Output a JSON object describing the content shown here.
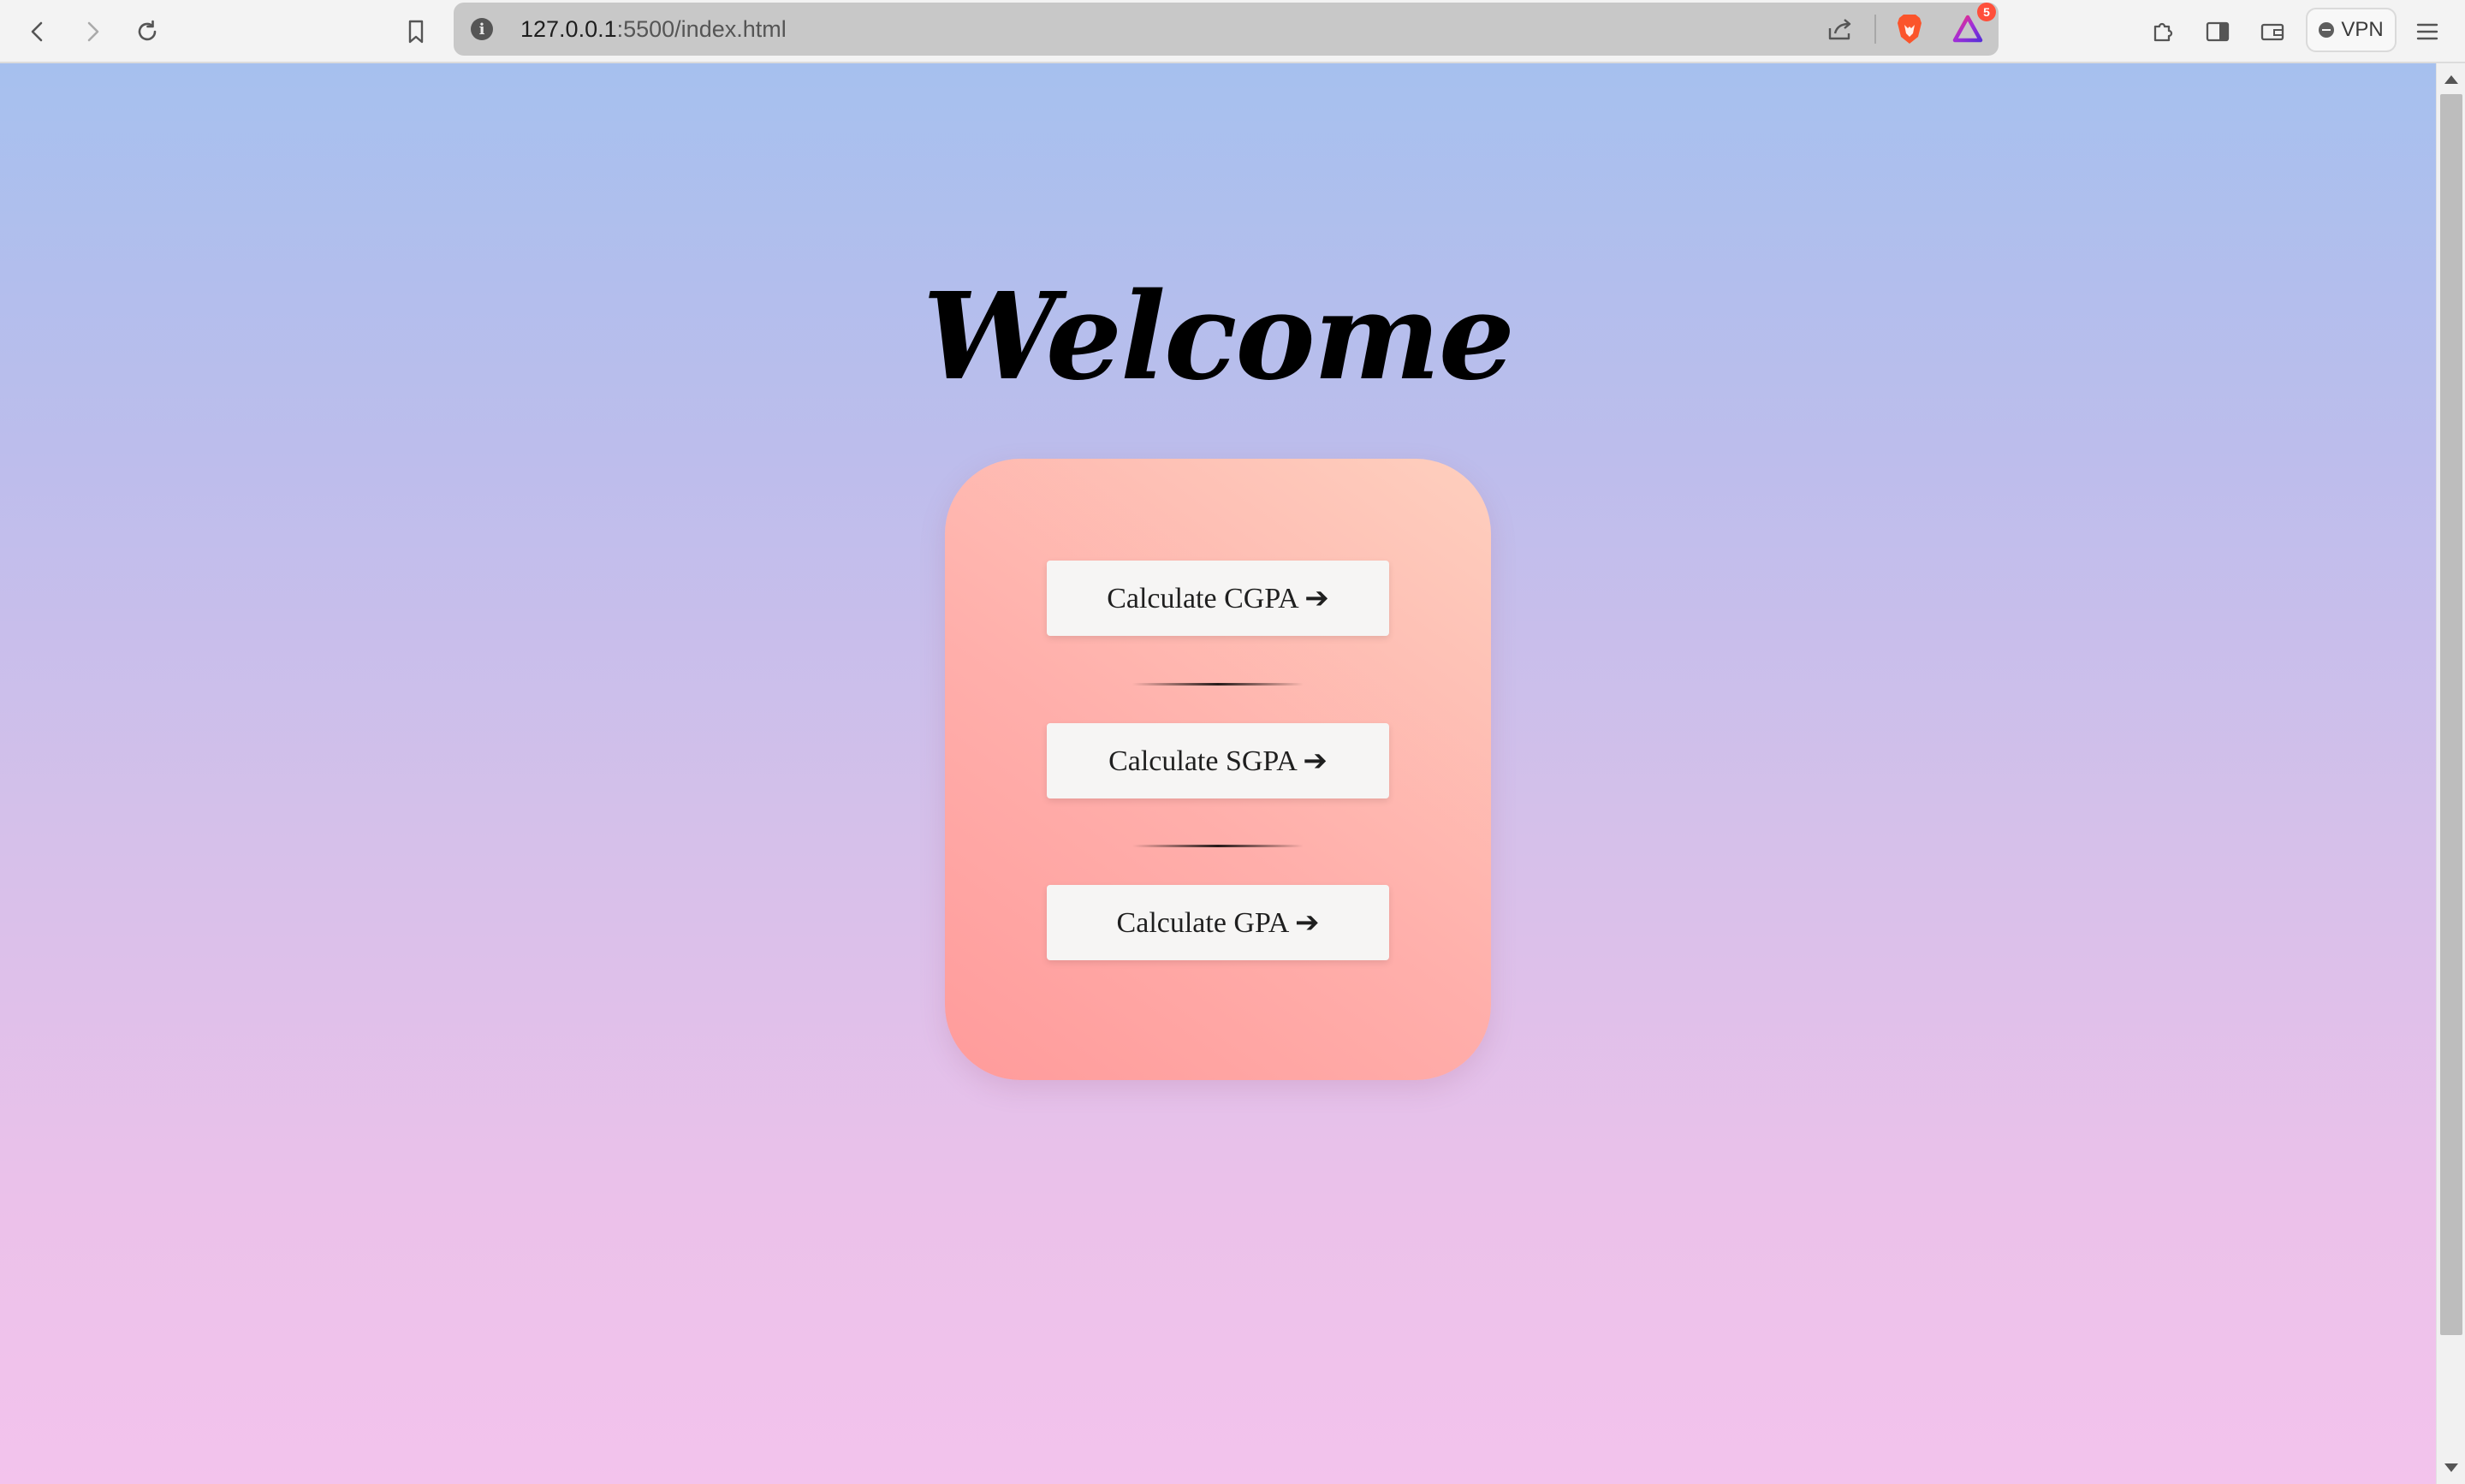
{
  "browser": {
    "url_host": "127.0.0.1",
    "url_rest": ":5500/index.html",
    "notification_count": "5",
    "vpn_label": "VPN",
    "icons": {
      "back": "back-arrow-icon",
      "forward": "forward-arrow-icon",
      "reload": "reload-icon",
      "bookmark": "bookmark-icon",
      "site_info": "info-icon",
      "share": "share-icon",
      "brave_shields": "brave-lion-icon",
      "rewards": "brave-rewards-triangle-icon",
      "extensions": "puzzle-piece-icon",
      "sidebar": "sidebar-icon",
      "wallet": "wallet-icon",
      "menu": "hamburger-menu-icon"
    }
  },
  "page": {
    "heading": "Welcome",
    "buttons": {
      "cgpa": "Calculate CGPA ➔",
      "sgpa": "Calculate SGPA ➔",
      "gpa": "Calculate GPA ➔"
    }
  },
  "colors": {
    "background_top": "#a6c0ee",
    "background_bottom": "#f3c3ec",
    "card_gradient_start": "#ff9b9b",
    "card_gradient_end": "#fecfbe",
    "button_background": "#f6f5f4",
    "brave_orange": "#fb542b",
    "badge_red": "#ff4f3a"
  }
}
